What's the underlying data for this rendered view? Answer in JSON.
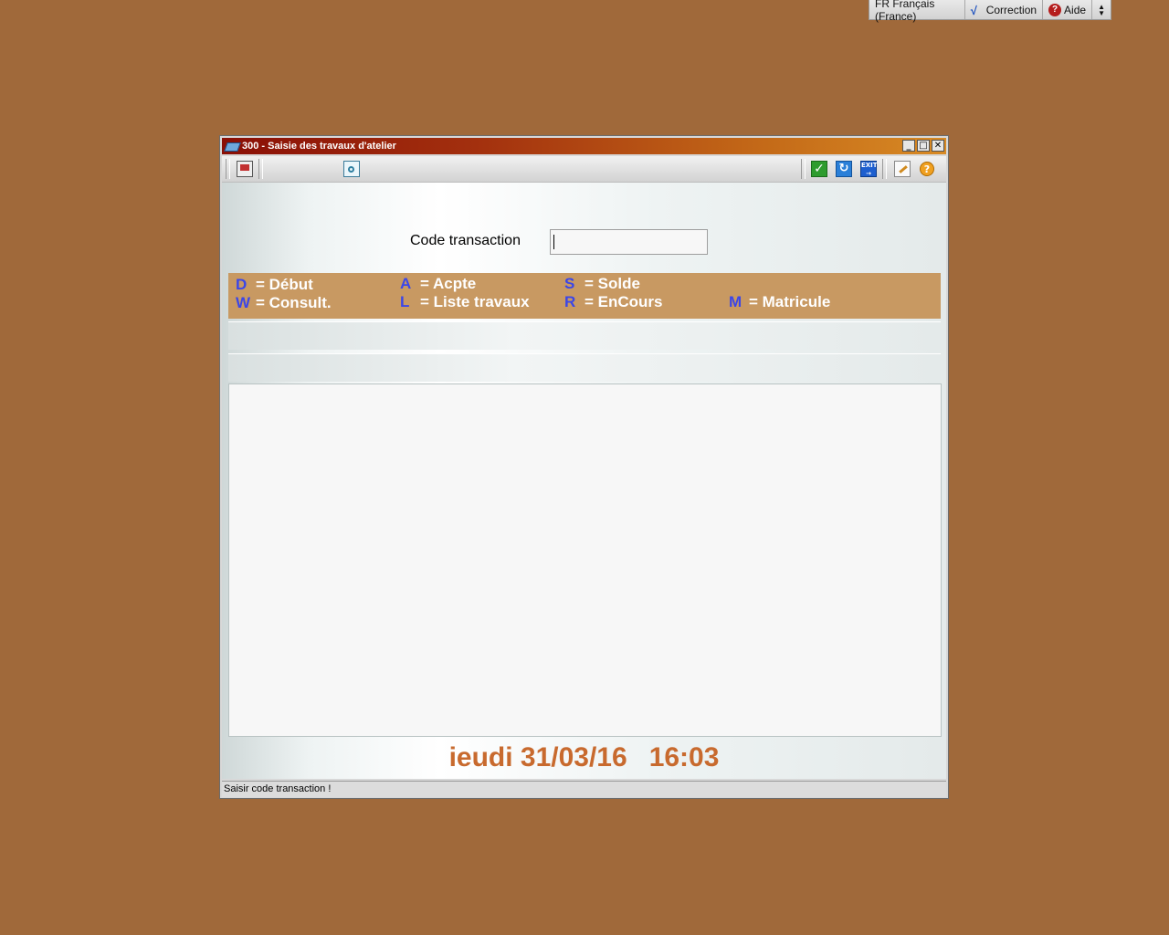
{
  "langbar": {
    "language": "FR Français (France)",
    "correction": "Correction",
    "help": "Aide"
  },
  "window": {
    "title": "300 - Saisie des travaux d'atelier",
    "minimize": "_",
    "maximize": "□",
    "close": "✕"
  },
  "toolbar": {
    "icons": [
      "save-icon",
      "preview-icon",
      "validate-icon",
      "refresh-icon",
      "exit-icon",
      "edit-icon",
      "help-icon"
    ],
    "exit_label": "EXIT",
    "help_label": "?"
  },
  "form": {
    "code_label": "Code transaction",
    "code_value": ""
  },
  "legend": {
    "items": [
      {
        "key": "D",
        "label": "= Début"
      },
      {
        "key": "A",
        "label": "= Acpte"
      },
      {
        "key": "S",
        "label": "= Solde"
      },
      {
        "key": "W",
        "label": "= Consult."
      },
      {
        "key": "L",
        "label": "= Liste travaux"
      },
      {
        "key": "R",
        "label": "= EnCours"
      },
      {
        "key": "M",
        "label": "= Matricule"
      }
    ],
    "key_color": "#3b46e8"
  },
  "footer": {
    "date": "ieudi 31/03/16",
    "time": "16:03",
    "color": "#c86a2e"
  },
  "status": {
    "message": "Saisir code transaction !"
  },
  "colors": {
    "desktop": "#a0693a",
    "legend_bg": "#c89962"
  }
}
